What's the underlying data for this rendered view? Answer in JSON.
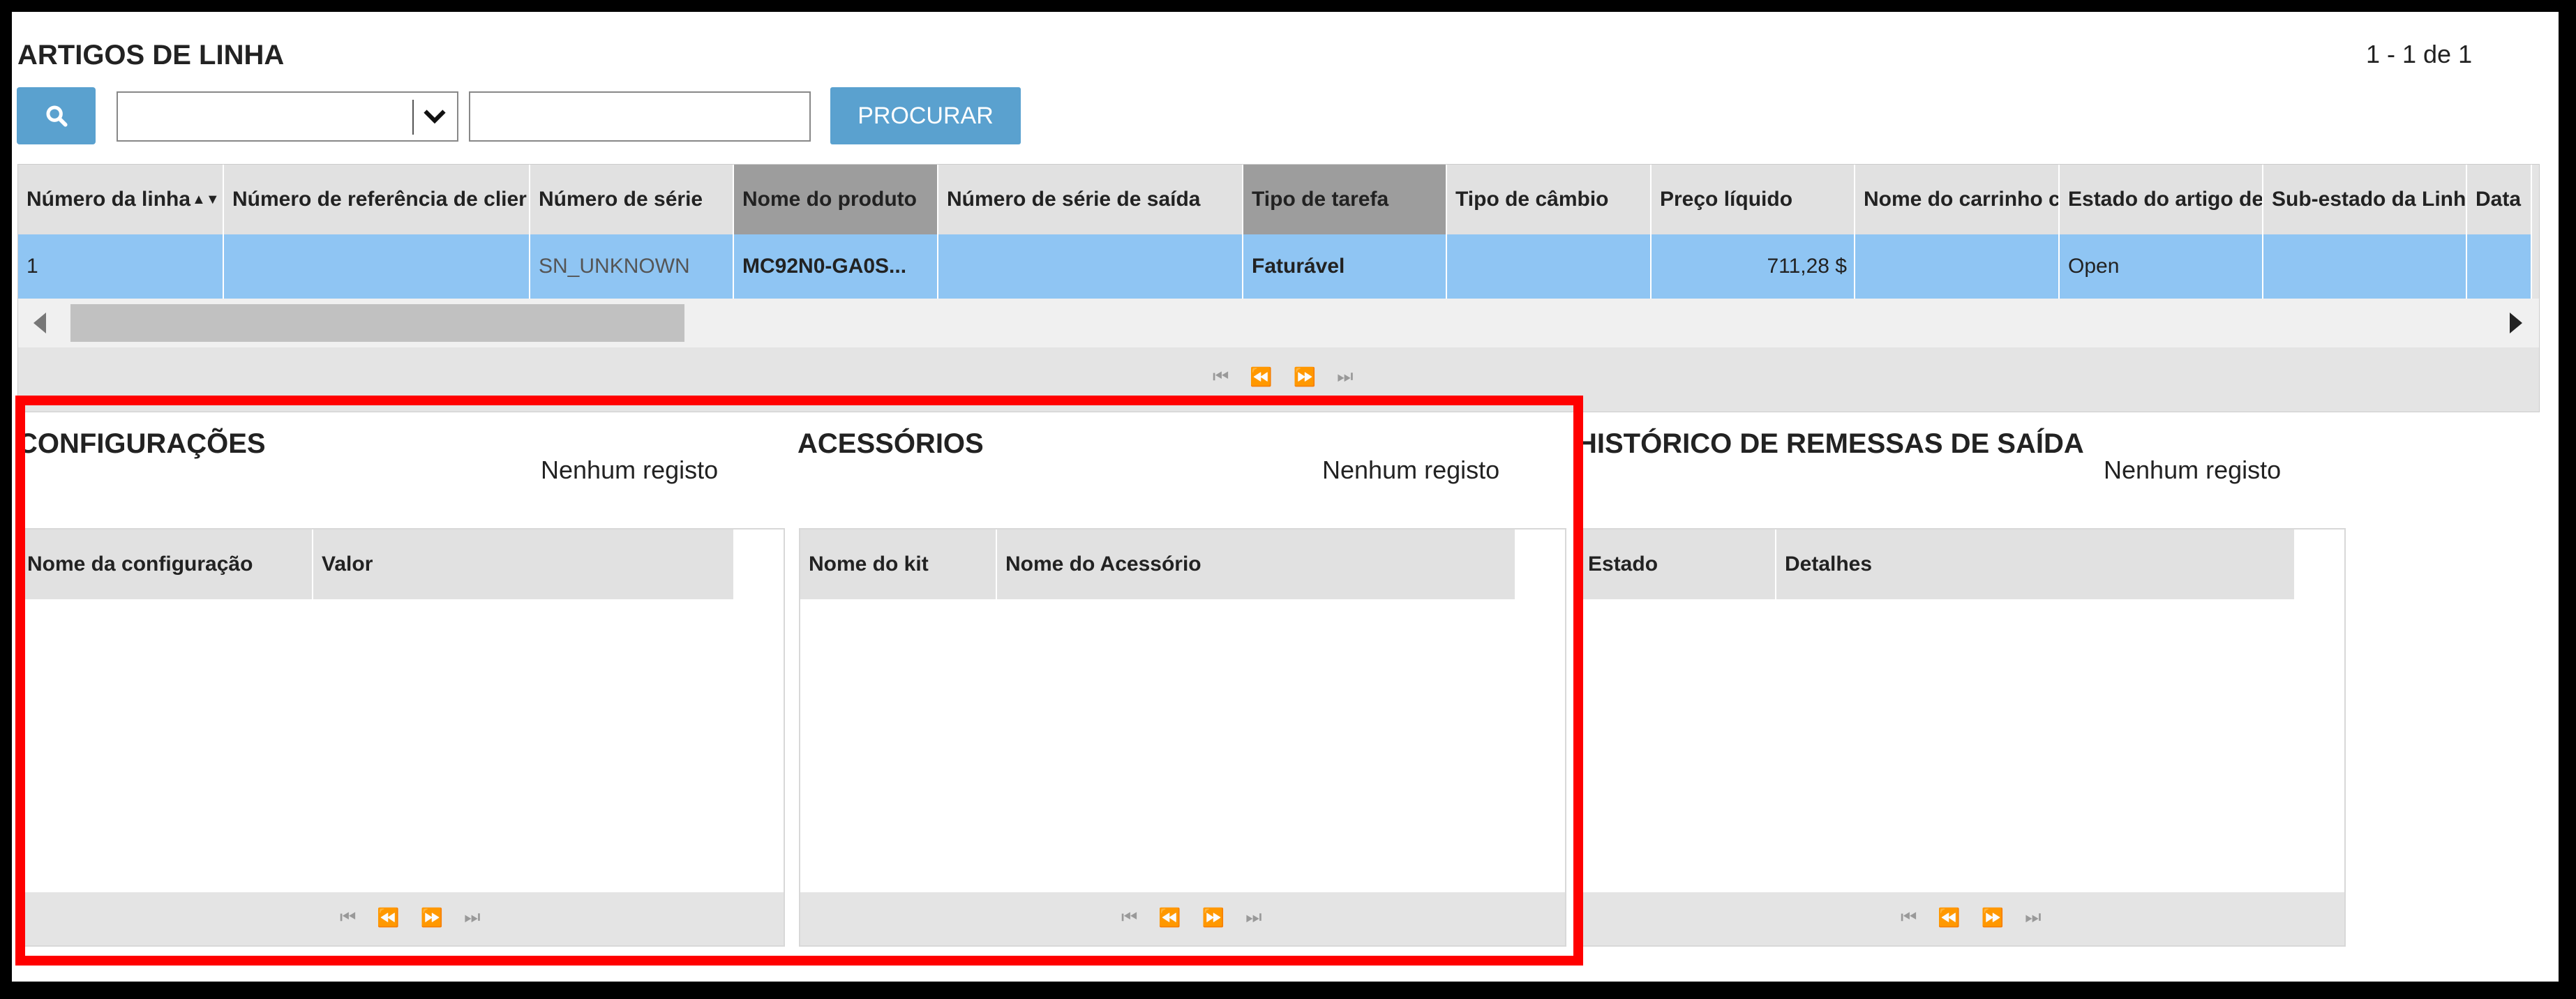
{
  "header": {
    "title": "ARTIGOS DE LINHA",
    "page_count": "1 - 1 de 1"
  },
  "toolbar": {
    "search_value": "",
    "search_button_label": "PROCURAR"
  },
  "main_grid": {
    "columns": [
      "Número da linha",
      "Número de referência de clier",
      "Número de série",
      "Nome do produto",
      "Número de série de saída",
      "Tipo de tarefa",
      "Tipo de câmbio",
      "Preço líquido",
      "Nome do carrinho c",
      "Estado do artigo de",
      "Sub-estado da Linh",
      "Data"
    ],
    "row": [
      "1",
      "",
      "SN_UNKNOWN",
      "MC92N0-GA0S...",
      "",
      "Faturável",
      "",
      "711,28 $",
      "",
      "Open",
      "",
      ""
    ],
    "sort_indicator": "▲▼"
  },
  "pager_glyphs": [
    "⏮",
    "⏪",
    "⏩",
    "⏭"
  ],
  "configuracoes": {
    "title": "CONFIGURAÇÕES",
    "empty": "Nenhum registo",
    "columns": [
      "Nome da configuração",
      "Valor"
    ]
  },
  "acessorios": {
    "title": "ACESSÓRIOS",
    "empty": "Nenhum registo",
    "columns": [
      "Nome do kit",
      "Nome do Acessório"
    ]
  },
  "historico": {
    "title": "HISTÓRICO DE REMESSAS DE SAÍDA",
    "empty": "Nenhum registo",
    "columns": [
      "Estado",
      "Detalhes"
    ]
  },
  "colors": {
    "accent": "#5aa1cf",
    "selected_row": "#8fc5f3",
    "highlight_border": "#ff0000"
  }
}
